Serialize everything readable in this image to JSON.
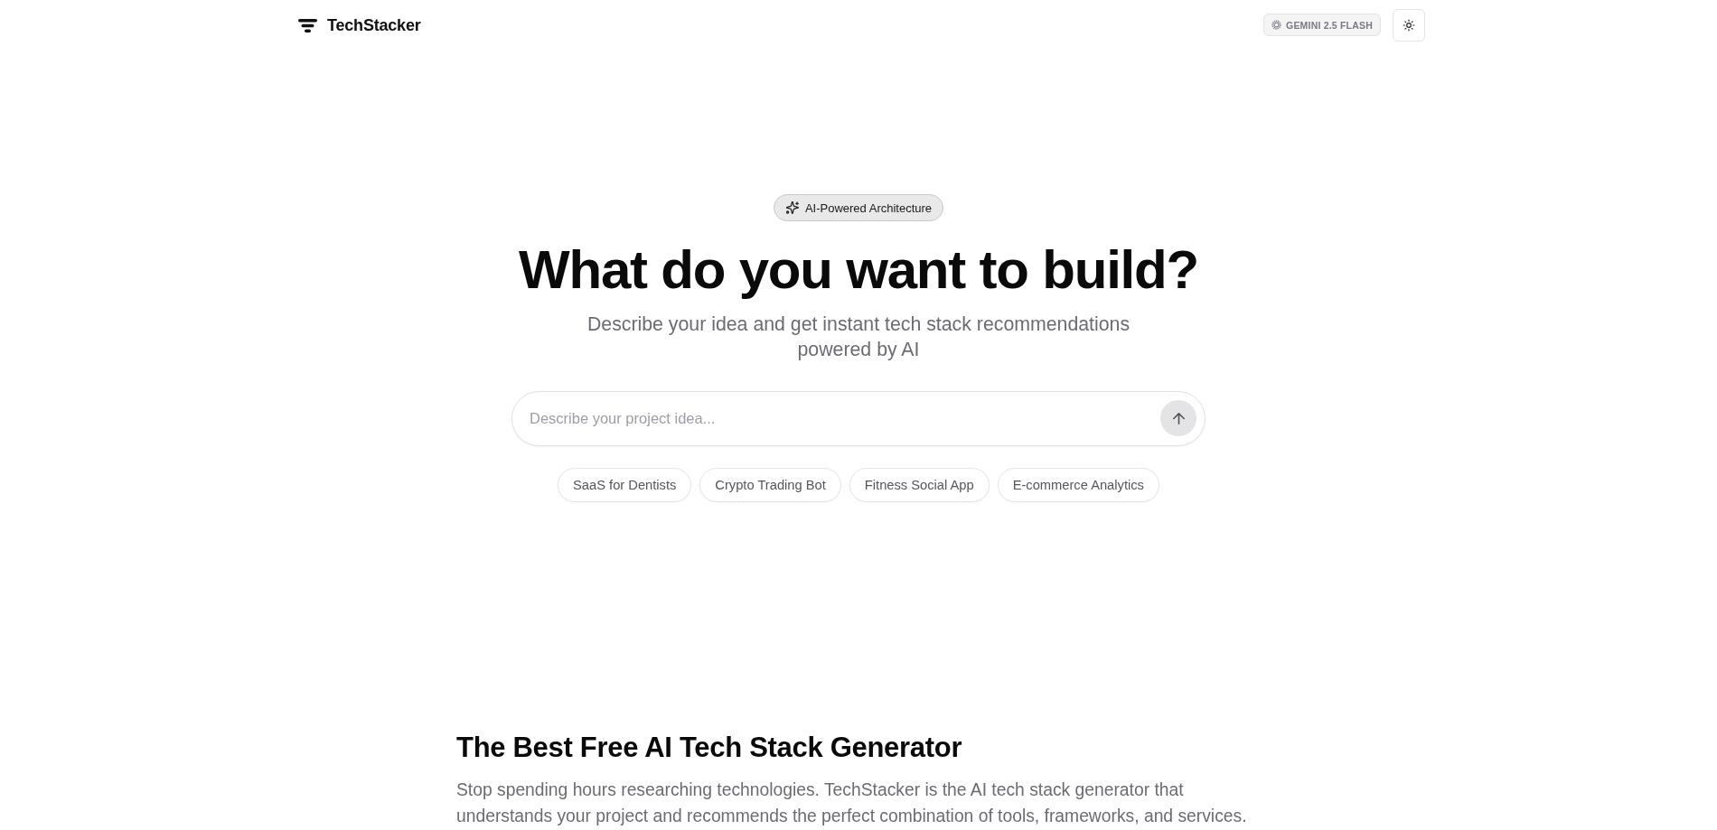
{
  "header": {
    "logo": "TechStacker",
    "model_badge": "GEMINI 2.5 FLASH"
  },
  "hero": {
    "badge": "AI-Powered Architecture",
    "title": "What do you want to build?",
    "subtitle": "Describe your idea and get instant tech stack recommendations powered by AI",
    "prompt": {
      "placeholder": "Describe your project idea...",
      "submit_disabled": true
    },
    "suggestions": [
      "SaaS for Dentists",
      "Crypto Trading Bot",
      "Fitness Social App",
      "E-commerce Analytics"
    ]
  },
  "section": {
    "title": "The Best Free AI Tech Stack Generator",
    "text": "Stop spending hours researching technologies. TechStacker is the AI tech stack generator that understands your project and recommends the perfect combination of tools, frameworks, and services."
  }
}
